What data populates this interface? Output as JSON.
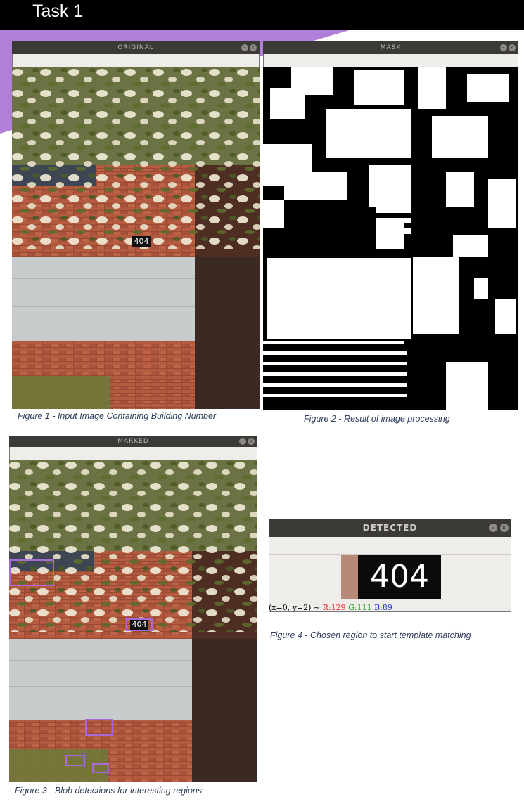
{
  "header": {
    "title": "Task 1"
  },
  "windows": {
    "original": {
      "title": "ORIGINAL",
      "plate_text": "404"
    },
    "mask": {
      "title": "MASK"
    },
    "marked": {
      "title": "MARKED",
      "plate_text": "404"
    },
    "detected": {
      "title": "DETECTED",
      "digits": "404",
      "status": {
        "coords": "(x=0, y=2) ~",
        "r": "R:129",
        "g": "G:111",
        "b": "B:89"
      }
    }
  },
  "captions": {
    "fig1": "Figure 1 - Input Image Containing Building Number",
    "fig2": "Figure 2 - Result of image processing",
    "fig3": "Figure 3 - Blob detections for interesting regions",
    "fig4": "Figure 4 - Chosen region to start template matching"
  },
  "colors": {
    "accent": "#b07fd8",
    "window_bar": "#3b3a37",
    "blob_box": "#a66bd6",
    "r": "#e02020",
    "g": "#20a020",
    "b": "#2030d0"
  },
  "icons": [
    "minimize-icon",
    "close-icon"
  ]
}
